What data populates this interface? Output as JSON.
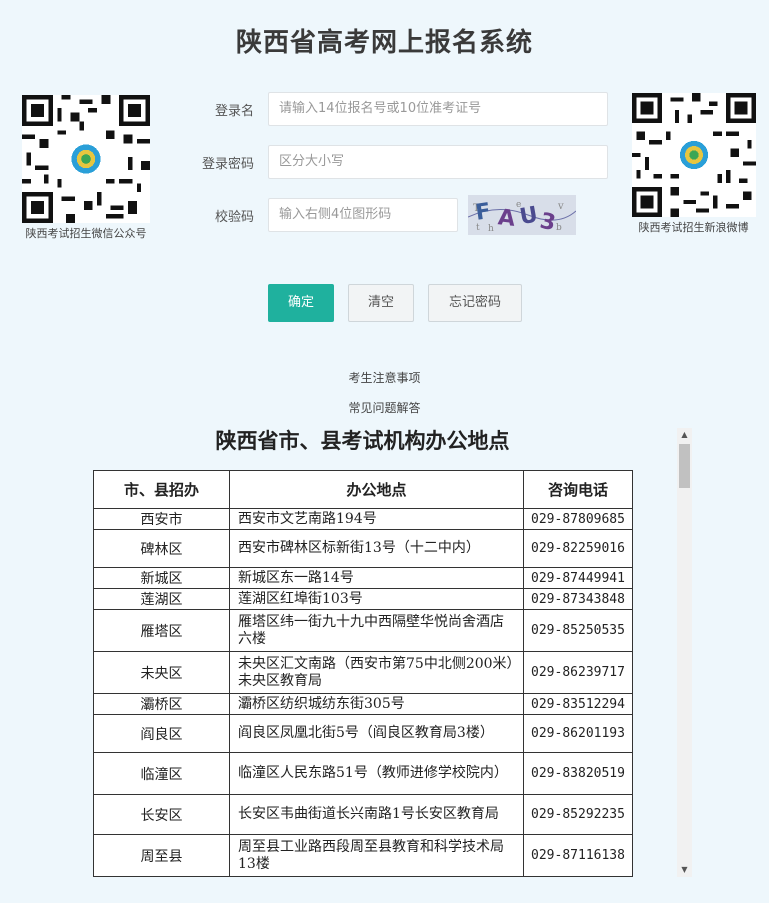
{
  "page": {
    "title": "陕西省高考网上报名系统"
  },
  "qr_left": {
    "caption": "陕西考试招生微信公众号"
  },
  "qr_right": {
    "caption": "陕西考试招生新浪微博"
  },
  "form": {
    "username": {
      "label": "登录名",
      "placeholder": "请输入14位报名号或10位准考证号"
    },
    "password": {
      "label": "登录密码",
      "placeholder": "区分大小写"
    },
    "captcha": {
      "label": "校验码",
      "placeholder": "输入右侧4位图形码",
      "image_text": "FAU3"
    }
  },
  "buttons": {
    "ok": "确定",
    "clear": "清空",
    "forgot": "忘记密码"
  },
  "links": {
    "notice": "考生注意事项",
    "faq": "常见问题解答"
  },
  "offices": {
    "title": "陕西省市、县考试机构办公地点",
    "headers": [
      "市、县招办",
      "办公地点",
      "咨询电话"
    ],
    "rows": [
      {
        "district": "西安市",
        "address": "西安市文艺南路194号",
        "phone": "029-87809685"
      },
      {
        "district": "碑林区",
        "address": "西安市碑林区标新街13号（十二中内）",
        "phone": "029-82259016"
      },
      {
        "district": "新城区",
        "address": "新城区东一路14号",
        "phone": "029-87449941"
      },
      {
        "district": "莲湖区",
        "address": "莲湖区红埠街103号",
        "phone": "029-87343848"
      },
      {
        "district": "雁塔区",
        "address": "雁塔区纬一街九十九中西隔壁华悦尚舍酒店六楼",
        "phone": "029-85250535"
      },
      {
        "district": "未央区",
        "address": "未央区汇文南路（西安市第75中北侧200米）未央区教育局",
        "phone": "029-86239717"
      },
      {
        "district": "灞桥区",
        "address": "灞桥区纺织城纺东街305号",
        "phone": "029-83512294"
      },
      {
        "district": "阎良区",
        "address": "阎良区凤凰北街5号（阎良区教育局3楼）",
        "phone": "029-86201193"
      },
      {
        "district": "临潼区",
        "address": "临潼区人民东路51号（教师进修学校院内）",
        "phone": "029-83820519"
      },
      {
        "district": "长安区",
        "address": "长安区韦曲街道长兴南路1号长安区教育局",
        "phone": "029-85292235"
      },
      {
        "district": "周至县",
        "address": "周至县工业路西段周至县教育和科学技术局13楼",
        "phone": "029-87116138"
      }
    ]
  },
  "colors": {
    "accent": "#1fb19e",
    "background": "#eef7fc"
  }
}
